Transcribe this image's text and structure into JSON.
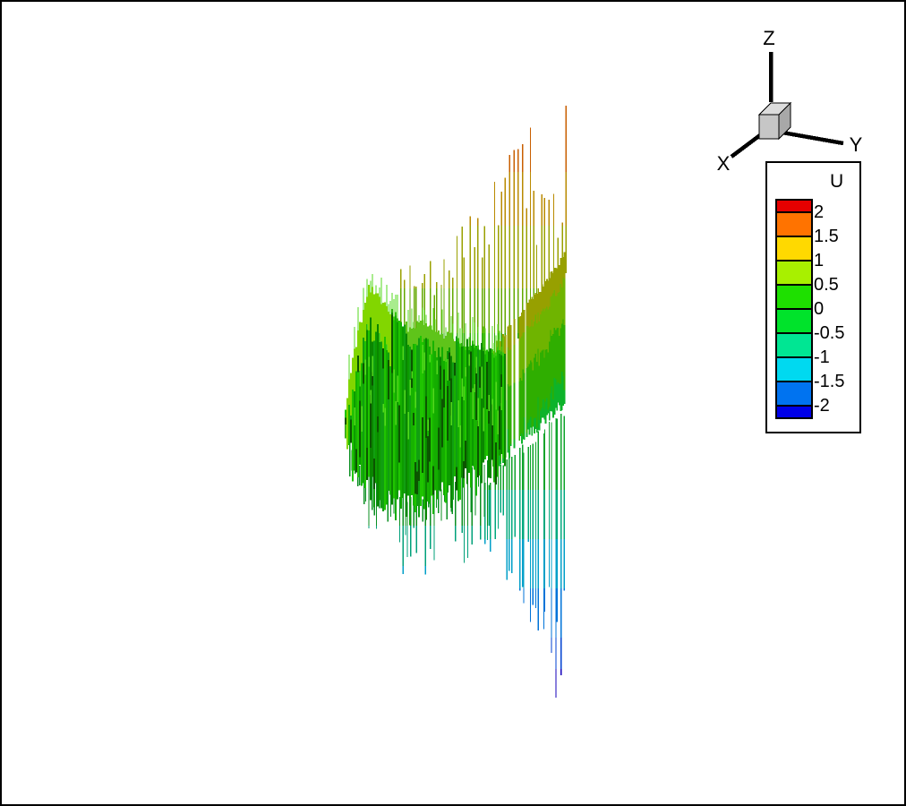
{
  "window": {
    "background": "#ffffff",
    "border_color": "#000000"
  },
  "orientation_axes": {
    "x_label": "X",
    "y_label": "Y",
    "z_label": "Z",
    "line_color": "#000000",
    "cube_front_fill": "#c6c6c6",
    "cube_top_fill": "#dcdcdc",
    "cube_right_fill": "#a8a8a8"
  },
  "legend": {
    "title": "U",
    "tick_labels": [
      "2",
      "1.5",
      "1",
      "0.5",
      "0",
      "-0.5",
      "-1",
      "-1.5",
      "-2"
    ],
    "swatch_colors_top_to_bottom": [
      "#e60000",
      "#ff7300",
      "#ffd900",
      "#a8f000",
      "#1ee000",
      "#00e32b",
      "#00e693",
      "#00d9f0",
      "#0073f0",
      "#0000e8"
    ],
    "border_color": "#000000",
    "background": "#ffffff"
  },
  "chart_data": {
    "type": "3d-stem-contour",
    "title": "",
    "variable": "U",
    "contour_levels": [
      2,
      1.5,
      1,
      0.5,
      0,
      -0.5,
      -1,
      -1.5,
      -2
    ],
    "level_colors_top_to_bottom": [
      "#e60000",
      "#ff7300",
      "#ffd900",
      "#a8f000",
      "#1ee000",
      "#00e32b",
      "#00e693",
      "#00d9f0",
      "#0073f0",
      "#0000e8"
    ],
    "value_range": [
      -2,
      2
    ],
    "axes_shown": [
      "X",
      "Y",
      "Z"
    ],
    "legend_position": "top-right",
    "description": "3D spike/stem field colored by U: dense green surface cluster at center-left with bright ridge peak, a diagonal wall of stems rising to the right, tall spikes with olive-orange-red tips reaching the top, and long stems with teal-cyan-blue-dark-blue tips descending below right.",
    "render_hints": {
      "seed": 20240601,
      "cluster": {
        "x_range": [
          384,
          562
        ],
        "step": 2,
        "top_profile": [
          [
            384,
            452
          ],
          [
            392,
            398
          ],
          [
            410,
            317
          ],
          [
            424,
            332
          ],
          [
            442,
            354
          ],
          [
            456,
            366
          ],
          [
            468,
            357
          ],
          [
            492,
            372
          ],
          [
            520,
            382
          ],
          [
            562,
            392
          ]
        ],
        "bottom_profile": [
          [
            384,
            468
          ],
          [
            392,
            518
          ],
          [
            402,
            540
          ],
          [
            422,
            550
          ],
          [
            442,
            562
          ],
          [
            462,
            568
          ],
          [
            482,
            560
          ],
          [
            502,
            548
          ],
          [
            522,
            536
          ],
          [
            544,
            524
          ],
          [
            562,
            516
          ]
        ],
        "top_jitter": 6,
        "bottom_jitter": 20,
        "palette": [
          "#14ad00",
          "#0c9b00",
          "#1fc400",
          "#0a8600",
          "#17b300",
          "#119e11"
        ],
        "dark_color": "#0b5500",
        "light_color": "#53d91c",
        "highlights": [
          {
            "x_range": [
              386,
              434
            ],
            "color": "#82d600",
            "length": 48
          },
          {
            "x_range": [
              452,
              506
            ],
            "color": "#5fc41a",
            "length": 22
          }
        ]
      },
      "band": {
        "x_range": [
          546,
          629
        ],
        "step": 1.4,
        "top_profile": [
          [
            546,
            390
          ],
          [
            570,
            360
          ],
          [
            600,
            323
          ],
          [
            629,
            283
          ]
        ],
        "bottom_profile": [
          [
            546,
            520
          ],
          [
            570,
            500
          ],
          [
            600,
            473
          ],
          [
            629,
            448
          ]
        ],
        "top_jitter": 4,
        "bottom_jitter": 7,
        "strata": [
          [
            28,
            "#97a000"
          ],
          [
            44,
            "#6fb400"
          ],
          [
            62,
            "#2fae00"
          ],
          [
            999,
            "#0db32a"
          ]
        ]
      },
      "top_spikes": {
        "x_range": [
          446,
          630
        ],
        "count": 42,
        "envelope_high": [
          [
            446,
            298
          ],
          [
            500,
            268
          ],
          [
            540,
            210
          ],
          [
            570,
            160
          ],
          [
            600,
            118
          ],
          [
            630,
            62
          ]
        ],
        "envelope_low": [
          [
            446,
            332
          ],
          [
            500,
            330
          ],
          [
            560,
            305
          ],
          [
            600,
            280
          ],
          [
            630,
            262
          ]
        ],
        "color_stops": [
          [
            115,
            "#c00000"
          ],
          [
            190,
            "#c85f00"
          ],
          [
            250,
            "#b98a00"
          ],
          [
            320,
            "#9aa000"
          ],
          [
            370,
            "#63a800"
          ],
          [
            9999,
            "#28a400"
          ]
        ]
      },
      "bottom_spikes_right": {
        "x_range": [
          540,
          628
        ],
        "count": 27,
        "envelope_shallow": [
          [
            540,
            555
          ],
          [
            590,
            585
          ],
          [
            628,
            640
          ]
        ],
        "envelope_deep": [
          [
            540,
            625
          ],
          [
            600,
            722
          ],
          [
            619,
            778
          ],
          [
            628,
            760
          ]
        ],
        "color_stops": [
          [
            545,
            "#0da32a"
          ],
          [
            600,
            "#00a87e"
          ],
          [
            655,
            "#009fc8"
          ],
          [
            710,
            "#0073d8"
          ],
          [
            745,
            "#0041d0"
          ],
          [
            9999,
            "#1400bb"
          ]
        ]
      },
      "bottom_spikes_left": {
        "x_range": [
          388,
          542
        ],
        "count": 50,
        "envelope_deep": [
          [
            388,
            565
          ],
          [
            420,
            602
          ],
          [
            455,
            655
          ],
          [
            500,
            642
          ],
          [
            542,
            605
          ]
        ],
        "color_stops": [
          [
            585,
            "#0b8f22"
          ],
          [
            630,
            "#00a07a"
          ],
          [
            9999,
            "#009fc8"
          ]
        ]
      }
    }
  }
}
